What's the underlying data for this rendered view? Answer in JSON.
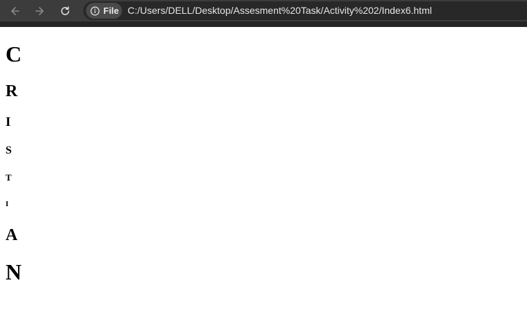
{
  "browser": {
    "url": "C:/Users/DELL/Desktop/Assesment%20Task/Activity%202/Index6.html",
    "site_chip_label": "File",
    "icons": {
      "back": "arrow-left-icon",
      "forward": "arrow-right-icon",
      "reload": "reload-icon",
      "info": "info-circle-icon"
    },
    "colors": {
      "toolbar": "#3c3c3c",
      "omnibox": "#282828",
      "text": "#e6e6e6"
    }
  },
  "page": {
    "headings": [
      {
        "level": "h1",
        "text": "C"
      },
      {
        "level": "h2",
        "text": "R"
      },
      {
        "level": "h3",
        "text": "I"
      },
      {
        "level": "h4",
        "text": "S"
      },
      {
        "level": "h5",
        "text": "T"
      },
      {
        "level": "h6",
        "text": "I"
      },
      {
        "level": "h2",
        "text": "A"
      },
      {
        "level": "h1",
        "text": "N"
      }
    ]
  }
}
